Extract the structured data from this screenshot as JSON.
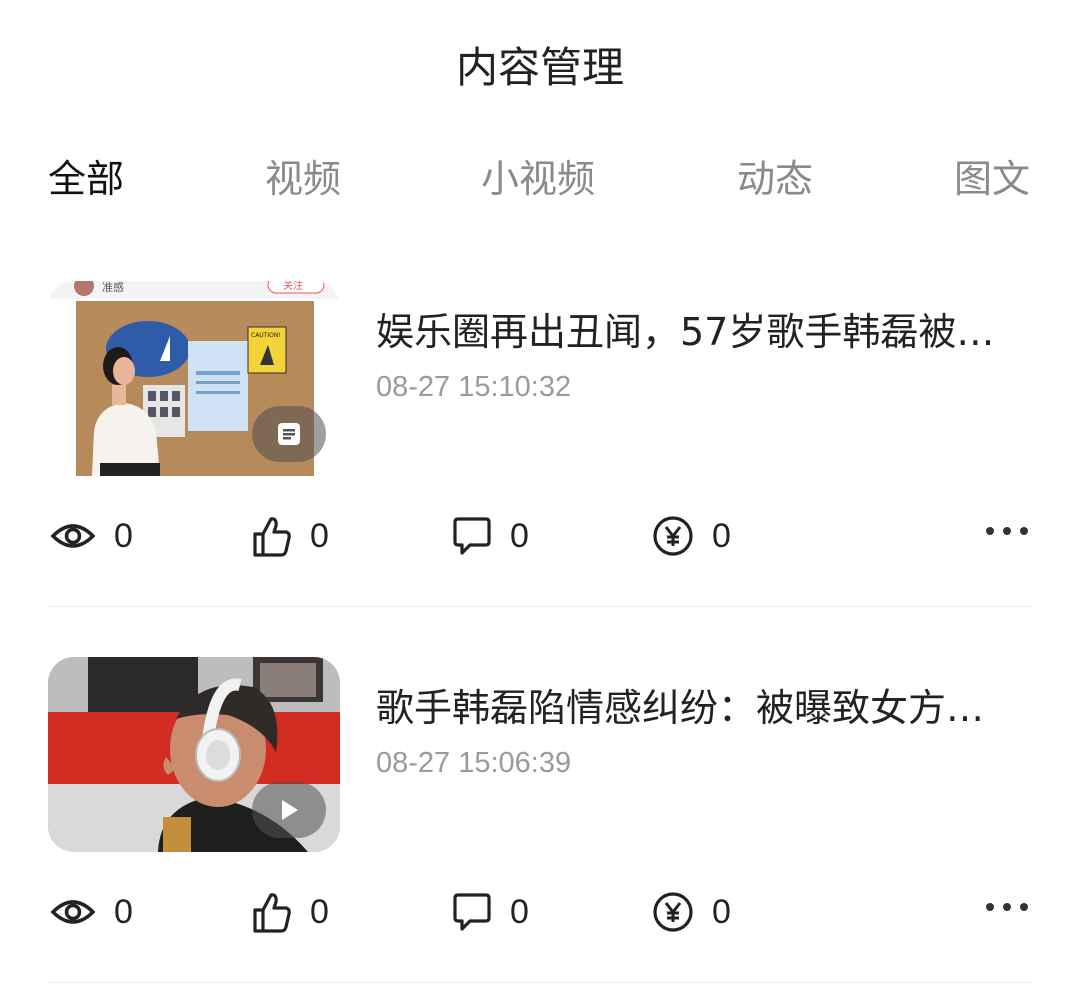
{
  "header": {
    "title": "内容管理"
  },
  "tabs": [
    {
      "label": "全部",
      "active": true
    },
    {
      "label": "视频",
      "active": false
    },
    {
      "label": "小视频",
      "active": false
    },
    {
      "label": "动态",
      "active": false
    },
    {
      "label": "图文",
      "active": false
    }
  ],
  "items": [
    {
      "title": "娱乐圈再出丑闻，57岁歌手韩磊被…",
      "time": "08-27 15:10:32",
      "badge_icon": "article-icon",
      "thumbnail_text": [
        "准感",
        "关注",
        "CAUTION!"
      ],
      "stats": {
        "views": "0",
        "likes": "0",
        "comments": "0",
        "earnings": "0"
      }
    },
    {
      "title": "歌手韩磊陷情感纠纷：被曝致女方…",
      "time": "08-27 15:06:39",
      "badge_icon": "play-icon",
      "stats": {
        "views": "0",
        "likes": "0",
        "comments": "0",
        "earnings": "0"
      }
    }
  ],
  "icons": [
    "eye-icon",
    "thumbs-up-icon",
    "comment-icon",
    "yuan-coin-icon",
    "more-icon"
  ],
  "colors": {
    "active_tab": "#111111",
    "inactive_tab": "#8a8a8a",
    "time": "#9a9a9a"
  }
}
